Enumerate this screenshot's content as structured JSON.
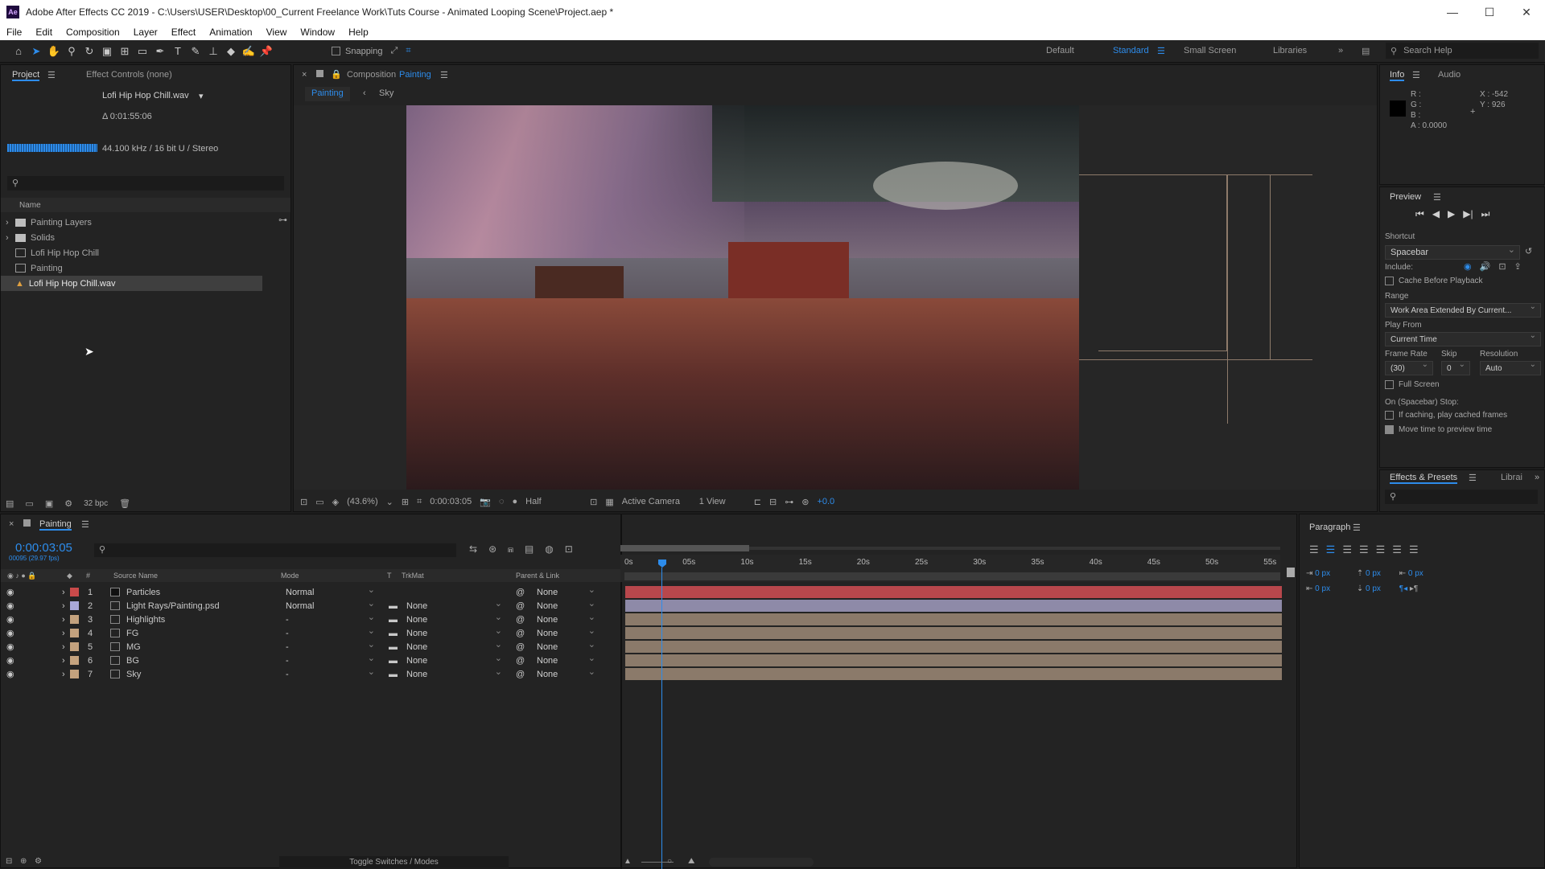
{
  "title": "Adobe After Effects CC 2019 - C:\\Users\\USER\\Desktop\\00_Current Freelance Work\\Tuts Course - Animated Looping Scene\\Project.aep *",
  "menu": [
    "File",
    "Edit",
    "Composition",
    "Layer",
    "Effect",
    "Animation",
    "View",
    "Window",
    "Help"
  ],
  "toolbar": {
    "snapping": "Snapping",
    "workspaces": [
      "Default",
      "Standard",
      "Small Screen",
      "Libraries"
    ],
    "search_placeholder": "Search Help"
  },
  "project": {
    "tab": "Project",
    "tab2": "Effect Controls (none)",
    "file_name": "Lofi Hip Hop Chill.wav",
    "duration": "Δ 0:01:55:06",
    "audio_info": "44.100 kHz / 16 bit U / Stereo",
    "col_name": "Name",
    "bpc": "32 bpc",
    "items": [
      {
        "name": "Painting Layers",
        "type": "folder"
      },
      {
        "name": "Solids",
        "type": "folder"
      },
      {
        "name": "Lofi Hip Hop Chill",
        "type": "comp"
      },
      {
        "name": "Painting",
        "type": "comp"
      },
      {
        "name": "Lofi Hip Hop Chill.wav",
        "type": "audio"
      }
    ]
  },
  "composition": {
    "tab_prefix": "Composition",
    "tab_name": "Painting",
    "flow": [
      "Painting",
      "Sky"
    ],
    "zoom": "(43.6%)",
    "time": "0:00:03:05",
    "resolution": "Half",
    "camera": "Active Camera",
    "views": "1 View",
    "exposure": "+0.0"
  },
  "info": {
    "tab": "Info",
    "tab2": "Audio",
    "r": "R :",
    "g": "G :",
    "b": "B :",
    "a": "A : 0.0000",
    "x": "X : -542",
    "y": "Y : 926"
  },
  "preview": {
    "title": "Preview",
    "shortcut_label": "Shortcut",
    "shortcut": "Spacebar",
    "include": "Include:",
    "cache": "Cache Before Playback",
    "range_label": "Range",
    "range": "Work Area Extended By Current...",
    "playfrom_label": "Play From",
    "playfrom": "Current Time",
    "fr_label": "Frame Rate",
    "skip_label": "Skip",
    "res_label": "Resolution",
    "fr": "(30)",
    "skip": "0",
    "res": "Auto",
    "fullscreen": "Full Screen",
    "stop_label": "On (Spacebar) Stop:",
    "opt1": "If caching, play cached frames",
    "opt2": "Move time to preview time"
  },
  "effects": {
    "tab": "Effects & Presets",
    "tab2": "Librai"
  },
  "paragraph": {
    "title": "Paragraph",
    "px": "0 px"
  },
  "timeline": {
    "tab": "Painting",
    "time": "0:00:03:05",
    "subtime": "00095 (29.97 fps)",
    "cols": {
      "source": "Source Name",
      "mode": "Mode",
      "t": "T",
      "trkmat": "TrkMat",
      "parent": "Parent & Link"
    },
    "ticks": [
      "0s",
      "05s",
      "10s",
      "15s",
      "20s",
      "25s",
      "30s",
      "35s",
      "40s",
      "45s",
      "50s",
      "55s"
    ],
    "layers": [
      {
        "num": "1",
        "name": "Particles",
        "mode": "Normal",
        "trk": "",
        "parent": "None",
        "label": "#c94a4a",
        "bar": "#b8474c"
      },
      {
        "num": "2",
        "name": "Light Rays/Painting.psd",
        "mode": "Normal",
        "trk": "None",
        "parent": "None",
        "label": "#a9a8d8",
        "bar": "#8e8aa8"
      },
      {
        "num": "3",
        "name": "Highlights",
        "mode": "-",
        "trk": "None",
        "parent": "None",
        "label": "#c4a27e",
        "bar": "#8b7a6a"
      },
      {
        "num": "4",
        "name": "FG",
        "mode": "-",
        "trk": "None",
        "parent": "None",
        "label": "#c4a27e",
        "bar": "#8b7a6a"
      },
      {
        "num": "5",
        "name": "MG",
        "mode": "-",
        "trk": "None",
        "parent": "None",
        "label": "#c4a27e",
        "bar": "#8b7a6a"
      },
      {
        "num": "6",
        "name": "BG",
        "mode": "-",
        "trk": "None",
        "parent": "None",
        "label": "#c4a27e",
        "bar": "#8b7a6a"
      },
      {
        "num": "7",
        "name": "Sky",
        "mode": "-",
        "trk": "None",
        "parent": "None",
        "label": "#c4a27e",
        "bar": "#8b7a6a"
      }
    ],
    "toggle": "Toggle Switches / Modes"
  },
  "colors": {
    "accent": "#2d8ceb"
  }
}
